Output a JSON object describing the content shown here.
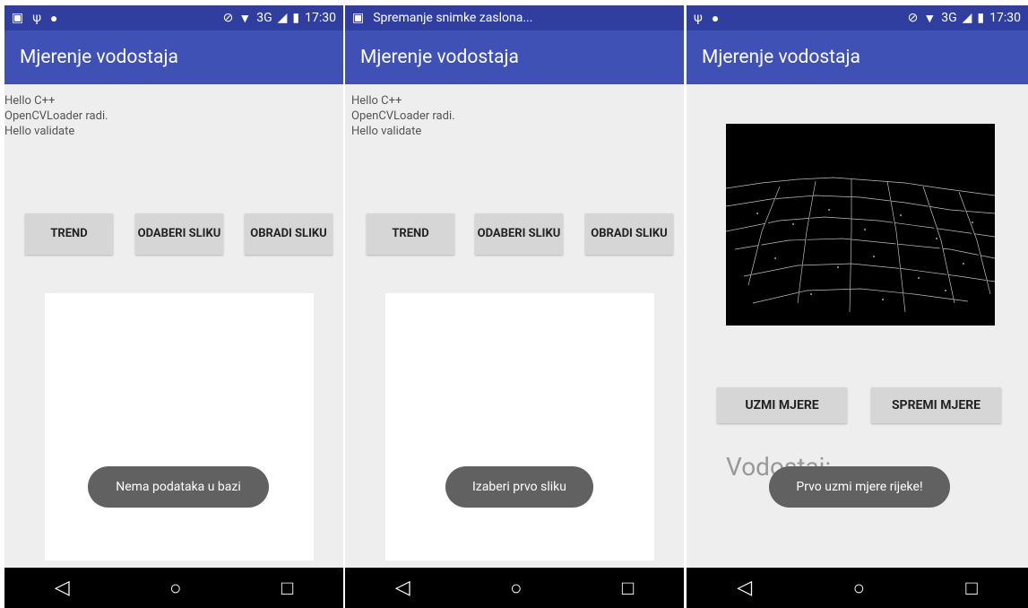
{
  "screens": [
    {
      "status": {
        "left_icons": [
          "image-icon",
          "usb-icon",
          "android-icon"
        ],
        "time": "17:30",
        "network": "3G"
      },
      "app_title": "Mjerenje vodostaja",
      "logs": [
        "Hello C++",
        "OpenCVLoader radi.",
        "Hello validate"
      ],
      "buttons": {
        "trend": "TREND",
        "odaberi": "ODABERI SLIKU",
        "obradi": "OBRADI SLIKU"
      },
      "toast": "Nema podataka u bazi"
    },
    {
      "status": {
        "notification": "Spremanje snimke zaslona..."
      },
      "app_title": "Mjerenje vodostaja",
      "logs": [
        "Hello C++",
        "OpenCVLoader radi.",
        "Hello validate"
      ],
      "buttons": {
        "trend": "TREND",
        "odaberi": "ODABERI SLIKU",
        "obradi": "OBRADI SLIKU"
      },
      "toast": "Izaberi prvo sliku"
    },
    {
      "status": {
        "time": "17:30",
        "network": "3G"
      },
      "app_title": "Mjerenje vodostaja",
      "buttons": {
        "uzmi": "UZMI MJERE",
        "spremi": "SPREMI MJERE"
      },
      "label": "Vodostaj:",
      "toast": "Prvo uzmi mjere rijeke!"
    }
  ],
  "nav": {
    "back": "◁",
    "home": "○",
    "recent": "□"
  },
  "colors": {
    "primary": "#3f51b5",
    "primary_dark": "#303f9f",
    "background": "#eeeeee"
  }
}
